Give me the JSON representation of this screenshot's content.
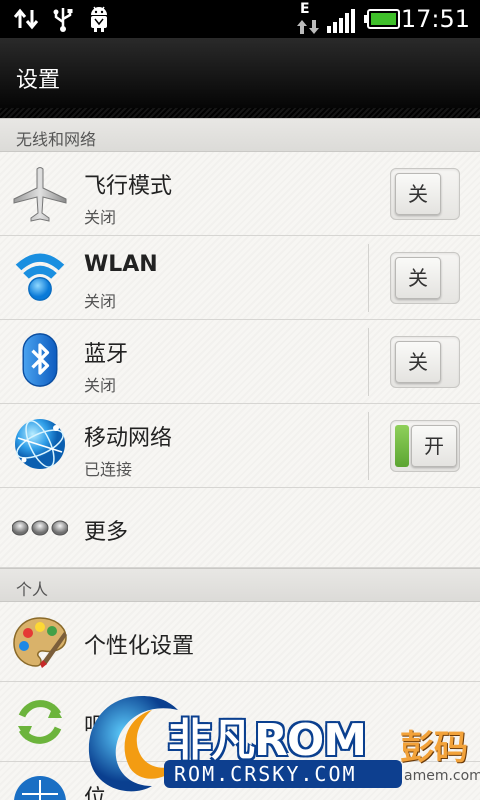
{
  "status_bar": {
    "time": "17:51",
    "network_type": "E",
    "icons": [
      "data-sync-icon",
      "usb-icon",
      "android-debug-icon",
      "network-activity-icon",
      "signal-icon",
      "battery-icon"
    ],
    "battery_color": "#3fbf2a"
  },
  "action_bar": {
    "title": "设置"
  },
  "sections": {
    "wireless": "无线和网络",
    "personal": "个人"
  },
  "rows": {
    "airplane": {
      "label": "飞行模式",
      "status": "关闭",
      "toggle": "关"
    },
    "wlan": {
      "label": "WLAN",
      "status": "关闭",
      "toggle": "关"
    },
    "bluetooth": {
      "label": "蓝牙",
      "status": "关闭",
      "toggle": "关"
    },
    "mobile": {
      "label": "移动网络",
      "status": "已连接",
      "toggle": "开"
    },
    "more": {
      "label": "更多"
    },
    "personalize": {
      "label": "个性化设置"
    },
    "sync": {
      "label": "吧"
    },
    "location": {
      "label": "位"
    }
  },
  "watermark": {
    "brand": "非凡ROM",
    "url": "ROM.CRSKY.COM",
    "tag": "彭码",
    "tag_sub": "amem.com"
  },
  "colors": {
    "toggle_on": "#6cb43c",
    "wlan_blue": "#1a8fe0",
    "bluetooth_blue": "#1565c0"
  }
}
